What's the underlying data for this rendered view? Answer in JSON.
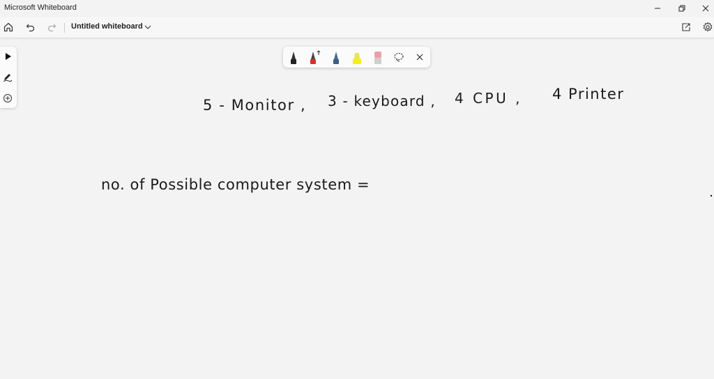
{
  "window": {
    "title": "Microsoft Whiteboard",
    "controls": {
      "minimize": "minimize-icon",
      "restore": "restore-icon",
      "close": "close-icon"
    }
  },
  "appbar": {
    "board_title": "Untitled whiteboard",
    "icons": {
      "home": "home-icon",
      "undo": "undo-icon",
      "redo": "redo-icon",
      "dropdown": "chevron-down-icon",
      "share": "share-icon",
      "settings": "gear-icon"
    }
  },
  "left_rail": {
    "tools": [
      {
        "name": "select",
        "icon": "pointer-icon"
      },
      {
        "name": "inking",
        "icon": "pen-icon"
      },
      {
        "name": "insert",
        "icon": "plus-icon"
      }
    ]
  },
  "pen_tray": {
    "pens": [
      {
        "name": "black",
        "color": "#222222"
      },
      {
        "name": "red",
        "color": "#e22b2b"
      },
      {
        "name": "blue",
        "color": "#3a5f86"
      },
      {
        "name": "yellow-highlighter",
        "color": "#f4ee1c"
      },
      {
        "name": "eraser",
        "color": "#e9a1a7"
      }
    ],
    "lasso_icon": "lasso-icon",
    "close_icon": "close-icon"
  },
  "canvas": {
    "background": "#f3f3f3",
    "ink_color": "#1a1a1a",
    "handwriting": [
      {
        "text": "5 - Monitor ,"
      },
      {
        "text": "3 - keyboard ,"
      },
      {
        "text": "4 CPU ,"
      },
      {
        "text": "4 Printer"
      },
      {
        "text": "no. of Possible computer system ="
      }
    ]
  }
}
